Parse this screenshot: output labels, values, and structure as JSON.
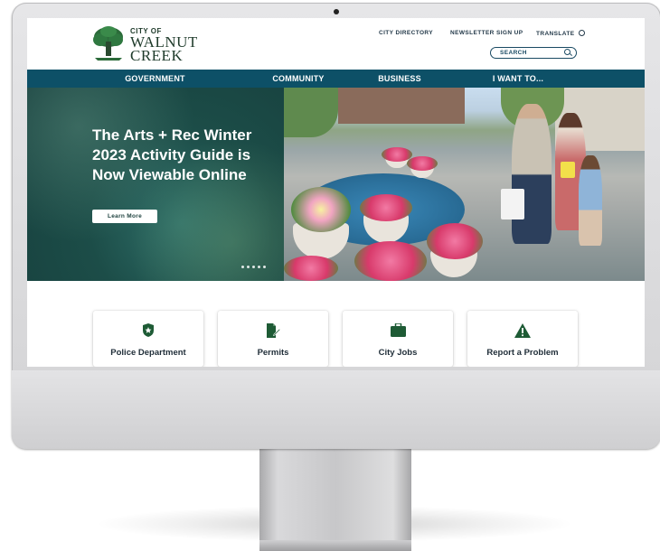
{
  "site": {
    "logo": {
      "line1": "CITY OF",
      "line2": "WALNUT",
      "line3": "CREEK"
    },
    "utility_links": [
      "CITY DIRECTORY",
      "NEWSLETTER SIGN UP",
      "TRANSLATE"
    ],
    "search": {
      "placeholder": "SEARCH"
    },
    "nav": [
      "GOVERNMENT",
      "COMMUNITY",
      "BUSINESS",
      "I WANT TO..."
    ],
    "hero": {
      "title": "The Arts + Rec Winter 2023 Activity Guide is Now Viewable Online",
      "button": "Learn More",
      "slide_count": 5
    },
    "cards": [
      {
        "label": "Police Department",
        "icon": "police-badge-icon"
      },
      {
        "label": "Permits",
        "icon": "permit-document-icon"
      },
      {
        "label": "City Jobs",
        "icon": "briefcase-icon"
      },
      {
        "label": "Report a Problem",
        "icon": "warning-icon"
      }
    ]
  },
  "colors": {
    "nav_bg": "#0d5067",
    "hero_panel": "#1c4d48",
    "icon_green": "#1e5b35",
    "access_green": "#1e8b3a"
  }
}
